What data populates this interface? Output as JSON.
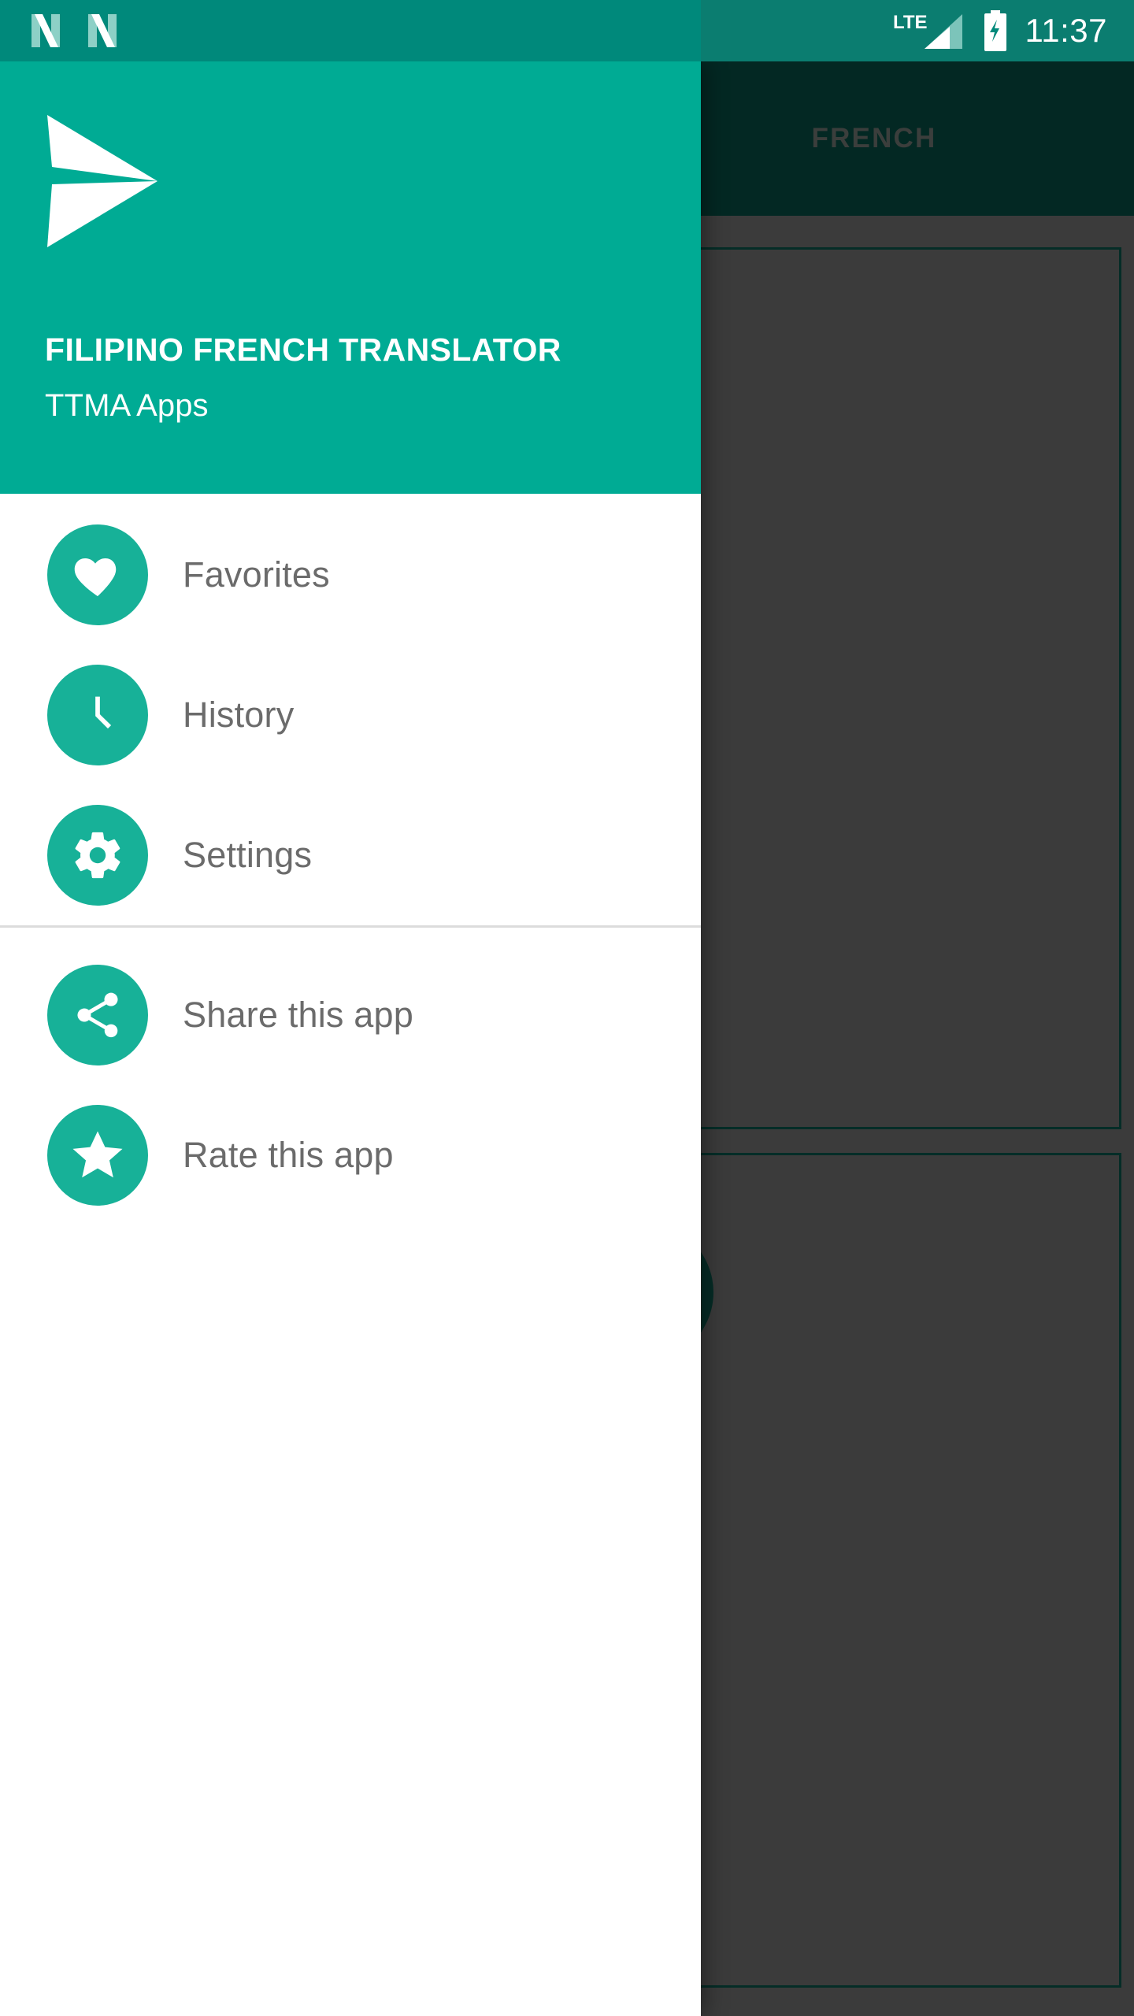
{
  "status_bar": {
    "notification_icons": [
      "android-n-icon",
      "android-n-icon"
    ],
    "network_label": "LTE",
    "signal_icon": "signal-triangle-icon",
    "battery_icon": "battery-charging-icon",
    "time": "11:37",
    "background_color": "#00897b",
    "text_color": "#ffffff"
  },
  "drawer": {
    "header": {
      "logo_icon": "paper-plane-send-icon",
      "title": "FILIPINO FRENCH TRANSLATOR",
      "subtitle": "TTMA Apps",
      "background_color": "#00ab94"
    },
    "groups": [
      {
        "items": [
          {
            "label": "Favorites",
            "icon": "heart-icon"
          },
          {
            "label": "History",
            "icon": "clock-icon"
          },
          {
            "label": "Settings",
            "icon": "gear-icon"
          }
        ]
      },
      {
        "items": [
          {
            "label": "Share this app",
            "icon": "share-icon"
          },
          {
            "label": "Rate this app",
            "icon": "star-icon"
          }
        ]
      }
    ],
    "icon_circle_color": "#17b198",
    "label_color": "#6b6b6b"
  },
  "background_app": {
    "toolbar": {
      "background_color": "#064a41",
      "tabs": [
        {
          "label": "FRENCH",
          "selected": false
        }
      ]
    },
    "scrim_color": "rgba(0,0,0,0.46)",
    "content_background": "#6d6d6d",
    "input_boxes": [
      {
        "name": "source-text-box",
        "border_color": "#0a5449"
      },
      {
        "name": "target-text-box",
        "border_color": "#0a5449"
      }
    ],
    "buttons": [
      {
        "name": "camera-fab",
        "icon": "camera-icon",
        "color": "#0a5247"
      },
      {
        "name": "translate-send-fab",
        "icon": "send-icon",
        "color": "#0a5247"
      }
    ]
  }
}
